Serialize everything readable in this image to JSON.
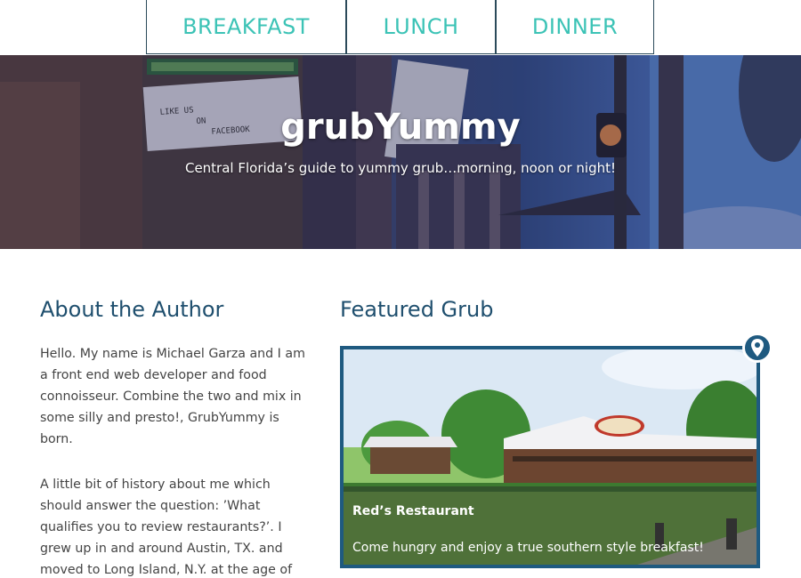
{
  "nav": {
    "tabs": [
      {
        "label": "BREAKFAST"
      },
      {
        "label": "LUNCH"
      },
      {
        "label": "DINNER"
      }
    ]
  },
  "hero": {
    "title": "grubYummy",
    "subtitle": "Central Florida’s guide to yummy grub…morning, noon or night!",
    "sign_text": "LIKE US ON FACEBOOK"
  },
  "about": {
    "heading": "About the Author",
    "paragraphs": [
      "Hello. My name is Michael Garza and I am a front end web developer and food connoisseur. Combine the two and mix in some silly and presto!, GrubYummy is born.",
      "A little bit of history about me which should answer the question: ’What qualifies you to review restaurants?’. I grew up in and around Austin, TX. and moved to Long Island, N.Y. at the age of"
    ]
  },
  "featured": {
    "heading": "Featured Grub",
    "card": {
      "name": "Red’s Restaurant",
      "description": "Come hungry and enjoy a true southern style breakfast!",
      "pin_icon": "map-pin-icon"
    }
  },
  "colors": {
    "accent_teal": "#3cc3b6",
    "heading_blue": "#1f4f6e",
    "card_border": "#1f5a80"
  }
}
